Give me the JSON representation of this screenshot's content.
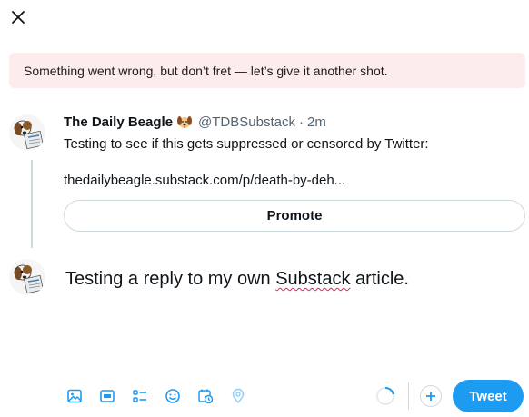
{
  "error_banner": {
    "message": "Something went wrong, but don’t fret — let’s give it another shot."
  },
  "tweet": {
    "display_name": "The Daily Beagle",
    "handle": "@TDBSubstack",
    "separator": "·",
    "time": "2m",
    "text": "Testing to see if this gets suppressed or censored by Twitter:",
    "link": "thedailybeagle.substack.com/p/death-by-deh...",
    "promote_label": "Promote"
  },
  "reply": {
    "text_before": "Testing a reply to my own ",
    "misspelled_word": "Substack",
    "text_after": " article."
  },
  "toolbar": {
    "icons": [
      "image-icon",
      "gif-icon",
      "poll-icon",
      "emoji-icon",
      "schedule-icon",
      "location-icon"
    ],
    "tweet_label": "Tweet"
  },
  "colors": {
    "accent": "#1d9bf0",
    "error_bg": "#fdecec",
    "border": "#cfd9de",
    "secondary_text": "#536471"
  }
}
